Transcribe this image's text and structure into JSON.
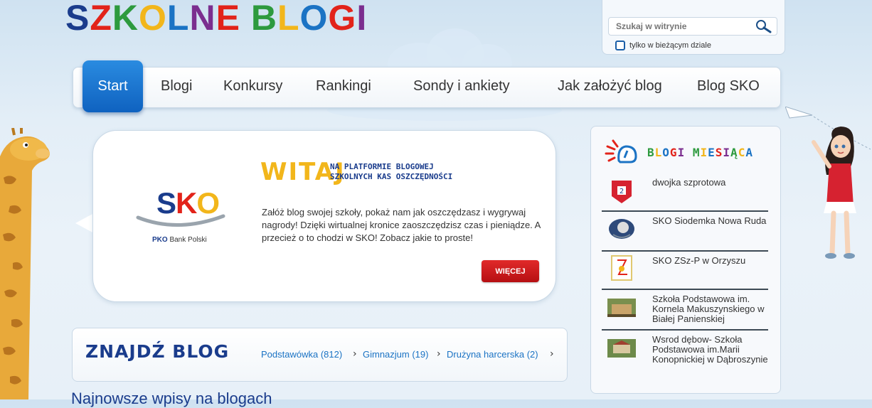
{
  "header": {
    "logo_text": "SZKOLNE BLOGI",
    "logo_colors": [
      "#1a3c8c",
      "#e2231a",
      "#2d9a3e",
      "#f2b61b",
      "#1b73c4",
      "#7b2e8f",
      "#e2231a",
      "#2d9a3e",
      "#f2b61b",
      "#1b73c4",
      "#e2231a",
      "#7b2e8f",
      "#2d9a3e"
    ]
  },
  "search": {
    "placeholder": "Szukaj w witrynie",
    "scope_label": "tylko w bieżącym dziale"
  },
  "nav": {
    "items": [
      "Start",
      "Blogi",
      "Konkursy",
      "Rankingi",
      "Sondy i ankiety",
      "Jak założyć blog",
      "Blog SKO"
    ],
    "active": "Start"
  },
  "welcome": {
    "title": "WITAJ",
    "subtitle_line1": "NA PLATFORMIE BLOGOWEJ",
    "subtitle_line2": "SZKOLNYCH KAS OSZCZĘDNOŚCI",
    "description": "Załóż blog swojej szkoły, pokaż nam jak oszczędzasz i wygrywaj nagrody! Dzięki wirtualnej kronice zaoszczędzisz czas i pieniądze. A przecież o to chodzi w SKO! Zobacz jakie to proste!",
    "more_label": "WIĘCEJ",
    "sko_logo": "SKO",
    "bank_name": "PKO Bank Polski"
  },
  "find_blog": {
    "title": "ZNAJDŹ BLOG",
    "links": [
      "Podstawówka (812)",
      "Gimnazjum (19)",
      "Drużyna harcerska (2)"
    ]
  },
  "blogs_of_month": {
    "title": "BLOGI MIESIĄCA",
    "items": [
      "dwojka szprotowa",
      "SKO Siodemka Nowa Ruda",
      "SKO ZSz-P w Orzyszu",
      "Szkoła Podstawowa im. Kornela Makuszynskiego w Białej Panienskiej",
      "Wsrod dębow- Szkoła Podstawowa im.Marii Konopnickiej w Dąbroszynie"
    ]
  },
  "bottom": {
    "partial_heading": "Najnowsze wpisy na blogach"
  }
}
